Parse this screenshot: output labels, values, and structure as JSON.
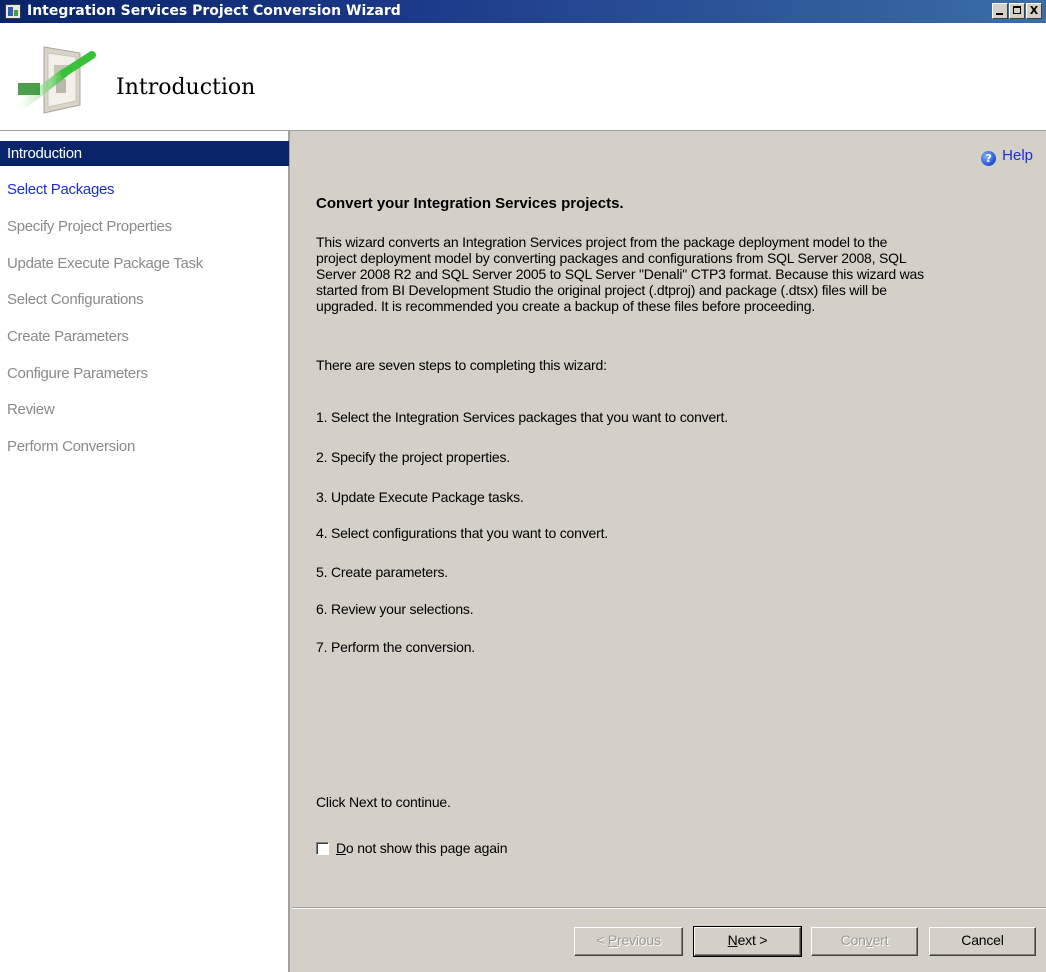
{
  "window": {
    "title": "Integration Services Project Conversion Wizard",
    "controls": [
      "minimize",
      "maximize",
      "close"
    ],
    "close_glyph": "X"
  },
  "header": {
    "title": "Introduction",
    "graphic": "wizard-conversion-graphic"
  },
  "sidebar": {
    "items": [
      {
        "label": "Introduction",
        "state": "active"
      },
      {
        "label": "Select Packages",
        "state": "link"
      },
      {
        "label": "Specify Project Properties",
        "state": "disabled"
      },
      {
        "label": "Update Execute Package Task",
        "state": "disabled"
      },
      {
        "label": "Select Configurations",
        "state": "disabled"
      },
      {
        "label": "Create Parameters",
        "state": "disabled"
      },
      {
        "label": "Configure Parameters",
        "state": "disabled"
      },
      {
        "label": "Review",
        "state": "disabled"
      },
      {
        "label": "Perform Conversion",
        "state": "disabled"
      }
    ]
  },
  "main": {
    "help": {
      "label": "Help",
      "icon": "help-icon",
      "icon_glyph": "?"
    },
    "heading": "Convert your Integration Services projects.",
    "intro_lines": [
      "This wizard converts an Integration Services project from the package deployment model to the",
      "project deployment model by converting packages and configurations from SQL Server 2008, SQL",
      "Server 2008 R2 and SQL Server 2005 to SQL Server \"Denali\" CTP3 format. Because this wizard was",
      "started from BI Development Studio the original project (.dtproj) and package (.dtsx) files will be",
      "upgraded. It is recommended you create a backup of these files before proceeding."
    ],
    "steps_intro": "There are seven steps to completing this wizard:",
    "steps": [
      "1. Select the Integration Services packages that you want to convert.",
      "2. Specify the project properties.",
      "3. Update Execute Package tasks.",
      "4. Select configurations that you want to convert.",
      "5. Create parameters.",
      "6. Review your selections.",
      "7. Perform the conversion."
    ],
    "continue_text": "Click Next to continue.",
    "checkbox": {
      "mnemonic": "D",
      "label_rest": "o not show this page again",
      "checked": false
    }
  },
  "buttons": {
    "previous": {
      "before": "< ",
      "mnemonic": "P",
      "after": "revious",
      "enabled": false
    },
    "next": {
      "before": "",
      "mnemonic": "N",
      "after": "ext >",
      "enabled": true
    },
    "convert": {
      "before": "Con",
      "mnemonic": "v",
      "after": "ert",
      "enabled": false
    },
    "cancel": {
      "label": "Cancel",
      "enabled": true
    }
  },
  "colors": {
    "title_bar": "#0a246a",
    "active_nav": "#0a246a",
    "link": "#1a2fcf",
    "disabled_nav": "#8a8a8a",
    "panel": "#d4d0c8"
  }
}
